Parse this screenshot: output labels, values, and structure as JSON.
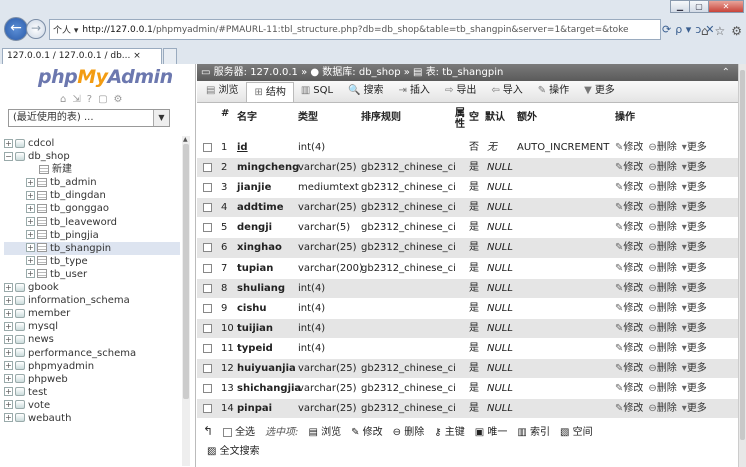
{
  "window": {
    "min_label": "▁",
    "max_label": "▢",
    "close_label": "✕"
  },
  "browser": {
    "back_icon": "arrow-left-icon",
    "address_chip": "个人 ▾",
    "address_host": "http://127.0.0.1",
    "address_path": "/phpmyadmin/#PMAURL-11:tbl_structure.php?db=db_shop&table=tb_shangpin&server=1&target=&toke",
    "tools": [
      "⟳",
      "ρ ▾",
      "ↄ",
      "✕"
    ],
    "right_icons": [
      "⌂",
      "☆",
      "⚙"
    ],
    "tab_title": "127.0.0.1 / 127.0.0.1 / db... ×"
  },
  "sidebar": {
    "logo_php": "php",
    "logo_my": "My",
    "logo_admin": "Admin",
    "db_select": "(最近使用的表) ...",
    "items": [
      {
        "label": "cdcol",
        "level": 1,
        "expand": "+",
        "type": "db"
      },
      {
        "label": "db_shop",
        "level": 1,
        "expand": "−",
        "type": "db"
      },
      {
        "label": "新建",
        "level": 2,
        "expand": "",
        "type": "new"
      },
      {
        "label": "tb_admin",
        "level": 2,
        "expand": "+",
        "type": "tbl"
      },
      {
        "label": "tb_dingdan",
        "level": 2,
        "expand": "+",
        "type": "tbl"
      },
      {
        "label": "tb_gonggao",
        "level": 2,
        "expand": "+",
        "type": "tbl"
      },
      {
        "label": "tb_leaveword",
        "level": 2,
        "expand": "+",
        "type": "tbl"
      },
      {
        "label": "tb_pingjia",
        "level": 2,
        "expand": "+",
        "type": "tbl"
      },
      {
        "label": "tb_shangpin",
        "level": 2,
        "expand": "+",
        "type": "tbl",
        "selected": true
      },
      {
        "label": "tb_type",
        "level": 2,
        "expand": "+",
        "type": "tbl"
      },
      {
        "label": "tb_user",
        "level": 2,
        "expand": "+",
        "type": "tbl"
      },
      {
        "label": "gbook",
        "level": 1,
        "expand": "+",
        "type": "db"
      },
      {
        "label": "information_schema",
        "level": 1,
        "expand": "+",
        "type": "db"
      },
      {
        "label": "member",
        "level": 1,
        "expand": "+",
        "type": "db"
      },
      {
        "label": "mysql",
        "level": 1,
        "expand": "+",
        "type": "db"
      },
      {
        "label": "news",
        "level": 1,
        "expand": "+",
        "type": "db"
      },
      {
        "label": "performance_schema",
        "level": 1,
        "expand": "+",
        "type": "db"
      },
      {
        "label": "phpmyadmin",
        "level": 1,
        "expand": "+",
        "type": "db"
      },
      {
        "label": "phpweb",
        "level": 1,
        "expand": "+",
        "type": "db"
      },
      {
        "label": "test",
        "level": 1,
        "expand": "+",
        "type": "db"
      },
      {
        "label": "vote",
        "level": 1,
        "expand": "+",
        "type": "db"
      },
      {
        "label": "webauth",
        "level": 1,
        "expand": "+",
        "type": "db"
      }
    ]
  },
  "breadcrumb": {
    "server": "服务器: 127.0.0.1",
    "sep": " » ",
    "database": "数据库: db_shop",
    "table": "表: tb_shangpin",
    "collapse": "⌃"
  },
  "tabs": [
    {
      "label": "浏览",
      "icon": "▤",
      "active": false
    },
    {
      "label": "结构",
      "icon": "⊞",
      "active": true
    },
    {
      "label": "SQL",
      "icon": "▥",
      "active": false
    },
    {
      "label": "搜索",
      "icon": "🔍",
      "active": false
    },
    {
      "label": "插入",
      "icon": "⇥",
      "active": false
    },
    {
      "label": "导出",
      "icon": "⇨",
      "active": false
    },
    {
      "label": "导入",
      "icon": "⇦",
      "active": false
    },
    {
      "label": "操作",
      "icon": "✎",
      "active": false
    },
    {
      "label": "更多",
      "icon": "▼",
      "active": false
    }
  ],
  "table": {
    "headers": {
      "num": "#",
      "name": "名字",
      "type": "类型",
      "collation": "排序规则",
      "attr": "属性",
      "null": "空",
      "default": "默认",
      "extra": "额外",
      "action": "操作"
    },
    "rows": [
      {
        "n": "1",
        "name": "id",
        "pk": true,
        "type": "int(4)",
        "collation": "",
        "null": "否",
        "default": "无",
        "extra": "AUTO_INCREMENT"
      },
      {
        "n": "2",
        "name": "mingcheng",
        "type": "varchar(25)",
        "collation": "gb2312_chinese_ci",
        "null": "是",
        "default": "NULL",
        "extra": ""
      },
      {
        "n": "3",
        "name": "jianjie",
        "type": "mediumtext",
        "collation": "gb2312_chinese_ci",
        "null": "是",
        "default": "NULL",
        "extra": ""
      },
      {
        "n": "4",
        "name": "addtime",
        "type": "varchar(25)",
        "collation": "gb2312_chinese_ci",
        "null": "是",
        "default": "NULL",
        "extra": ""
      },
      {
        "n": "5",
        "name": "dengji",
        "type": "varchar(5)",
        "collation": "gb2312_chinese_ci",
        "null": "是",
        "default": "NULL",
        "extra": ""
      },
      {
        "n": "6",
        "name": "xinghao",
        "type": "varchar(25)",
        "collation": "gb2312_chinese_ci",
        "null": "是",
        "default": "NULL",
        "extra": ""
      },
      {
        "n": "7",
        "name": "tupian",
        "type": "varchar(200)",
        "collation": "gb2312_chinese_ci",
        "null": "是",
        "default": "NULL",
        "extra": ""
      },
      {
        "n": "8",
        "name": "shuliang",
        "type": "int(4)",
        "collation": "",
        "null": "是",
        "default": "NULL",
        "extra": ""
      },
      {
        "n": "9",
        "name": "cishu",
        "type": "int(4)",
        "collation": "",
        "null": "是",
        "default": "NULL",
        "extra": ""
      },
      {
        "n": "10",
        "name": "tuijian",
        "type": "int(4)",
        "collation": "",
        "null": "是",
        "default": "NULL",
        "extra": ""
      },
      {
        "n": "11",
        "name": "typeid",
        "type": "int(4)",
        "collation": "",
        "null": "是",
        "default": "NULL",
        "extra": ""
      },
      {
        "n": "12",
        "name": "huiyuanjia",
        "type": "varchar(25)",
        "collation": "gb2312_chinese_ci",
        "null": "是",
        "default": "NULL",
        "extra": ""
      },
      {
        "n": "13",
        "name": "shichangjia",
        "type": "varchar(25)",
        "collation": "gb2312_chinese_ci",
        "null": "是",
        "default": "NULL",
        "extra": ""
      },
      {
        "n": "14",
        "name": "pinpai",
        "type": "varchar(25)",
        "collation": "gb2312_chinese_ci",
        "null": "是",
        "default": "NULL",
        "extra": ""
      }
    ],
    "row_actions": {
      "edit": "修改",
      "drop": "删除",
      "more": "更多"
    }
  },
  "footer": {
    "check_all": "全选",
    "with_selected": "选中项:",
    "browse": "浏览",
    "edit": "修改",
    "drop": "删除",
    "primary": "主键",
    "unique": "唯一",
    "index": "索引",
    "spatial": "空间",
    "fulltext": "全文搜索"
  }
}
